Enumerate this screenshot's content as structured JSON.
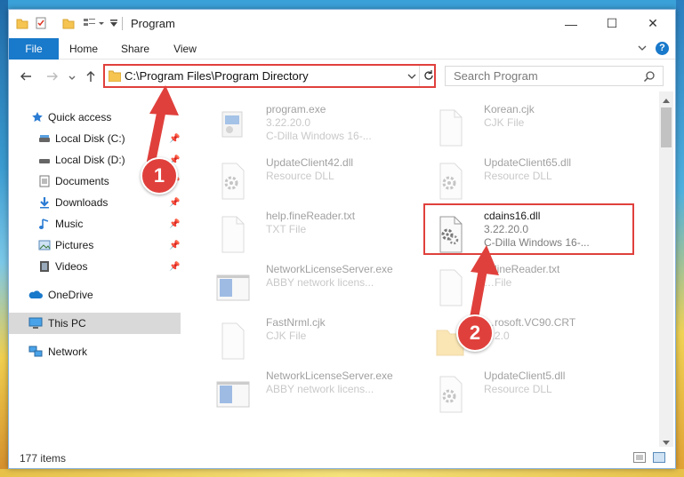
{
  "window": {
    "title": "Program",
    "controls": {
      "minimize": "—",
      "maximize": "☐",
      "close": "✕"
    }
  },
  "ribbon": {
    "tabs": [
      {
        "label": "File"
      },
      {
        "label": "Home"
      },
      {
        "label": "Share"
      },
      {
        "label": "View"
      }
    ],
    "help_label": "?"
  },
  "address": {
    "path": "C:\\Program Files\\Program Directory",
    "search_placeholder": "Search Program"
  },
  "nav": {
    "items": [
      {
        "label": "Quick access",
        "icon": "star-icon"
      },
      {
        "label": "Local Disk (C:)",
        "icon": "drive-icon",
        "pinned": true
      },
      {
        "label": "Local Disk (D:)",
        "icon": "drive-icon",
        "pinned": true
      },
      {
        "label": "Documents",
        "icon": "documents-icon",
        "pinned": true
      },
      {
        "label": "Downloads",
        "icon": "downloads-icon",
        "pinned": true
      },
      {
        "label": "Music",
        "icon": "music-icon",
        "pinned": true
      },
      {
        "label": "Pictures",
        "icon": "pictures-icon",
        "pinned": true
      },
      {
        "label": "Videos",
        "icon": "videos-icon",
        "pinned": true
      },
      {
        "label": "OneDrive",
        "icon": "onedrive-icon"
      },
      {
        "label": "This PC",
        "icon": "this-pc-icon",
        "selected": true
      },
      {
        "label": "Network",
        "icon": "network-icon"
      }
    ]
  },
  "files": [
    {
      "name": "program.exe",
      "line2": "3.22.20.0",
      "line3": "C-Dilla Windows 16-...",
      "icon": "exe-icon"
    },
    {
      "name": "Korean.cjk",
      "line2": "CJK File",
      "line3": "",
      "icon": "blank-file-icon"
    },
    {
      "name": "UpdateClient42.dll",
      "line2": "Resource DLL",
      "line3": "",
      "icon": "dll-gear-icon"
    },
    {
      "name": "UpdateClient65.dll",
      "line2": "Resource DLL",
      "line3": "",
      "icon": "dll-gear-icon"
    },
    {
      "name": "help.fineReader.txt",
      "line2": "TXT File",
      "line3": "",
      "icon": "blank-file-icon"
    },
    {
      "name": "cdains16.dll",
      "line2": "3.22.20.0",
      "line3": "C-Dilla Windows 16-...",
      "icon": "dll-gear-icon"
    },
    {
      "name": "NetworkLicenseServer.exe",
      "line2": "ABBY network licens...",
      "line3": "",
      "icon": "app-window-icon"
    },
    {
      "name": "…lineReader.txt",
      "line2": "…File",
      "line3": "",
      "icon": "blank-file-icon"
    },
    {
      "name": "FastNrml.cjk",
      "line2": "CJK File",
      "line3": "",
      "icon": "blank-file-icon"
    },
    {
      "name": "…rosoft.VC90.CRT",
      "line2": "…2.0",
      "line3": "",
      "icon": "folder-icon"
    },
    {
      "name": "NetworkLicenseServer.exe",
      "line2": "ABBY network licens...",
      "line3": "",
      "icon": "app-window-icon"
    },
    {
      "name": "UpdateClient5.dll",
      "line2": "Resource DLL",
      "line3": "",
      "icon": "dll-gear-icon"
    }
  ],
  "status": {
    "count_text": "177 items"
  },
  "callouts": {
    "step1": "1",
    "step2": "2"
  },
  "colors": {
    "accent": "#1979ca",
    "callout": "#e0403c"
  }
}
